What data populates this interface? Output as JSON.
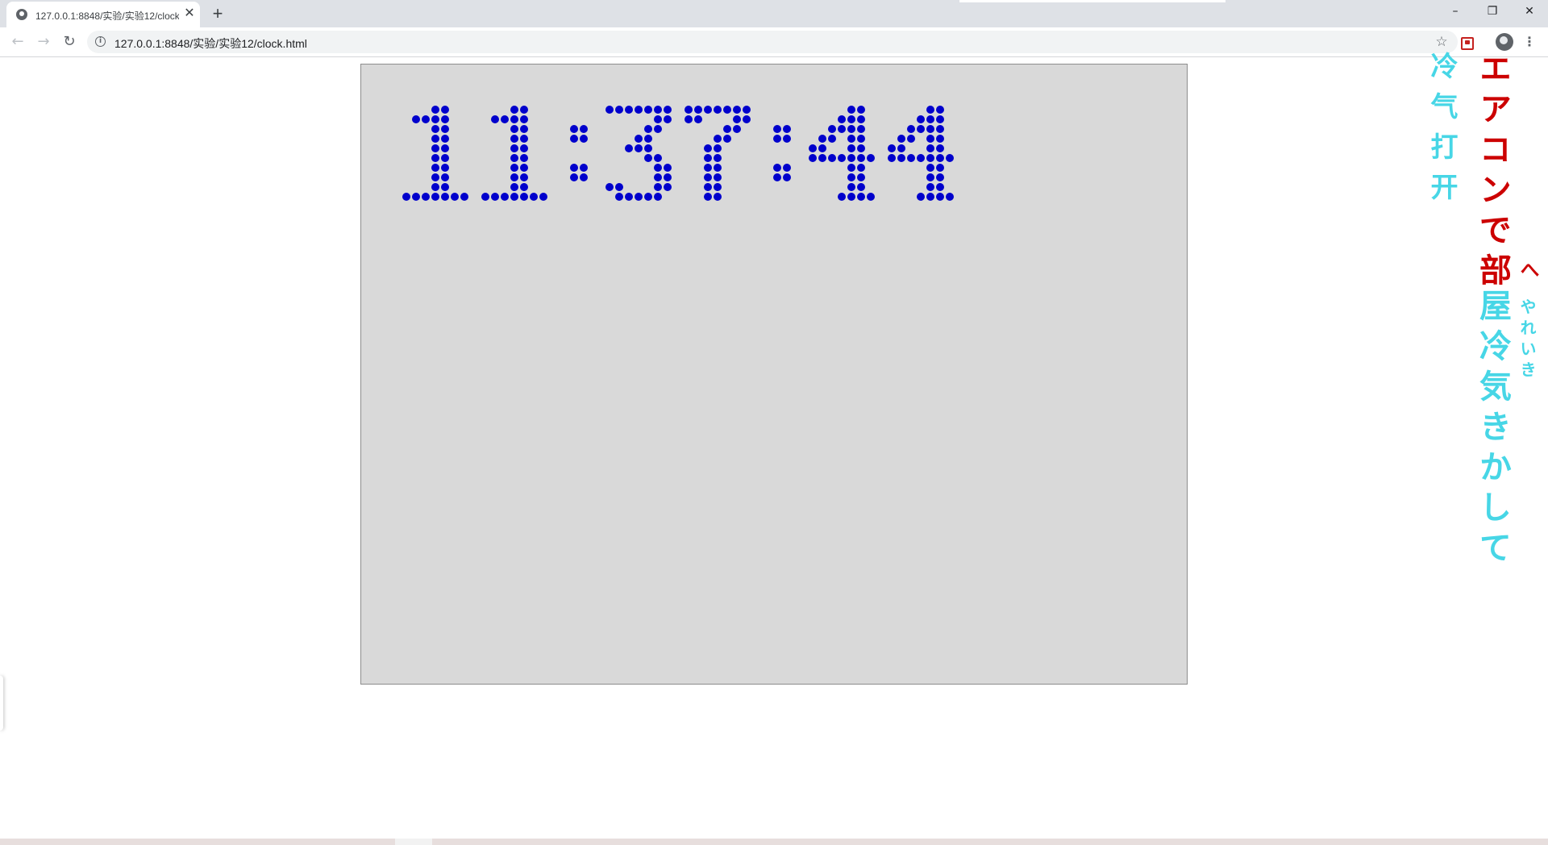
{
  "browser": {
    "tab": {
      "title": "127.0.0.1:8848/实验/实验12/clock.html",
      "favicon": "globe-icon"
    },
    "controls": {
      "new_tab": "+",
      "minimize": "–",
      "restore": "❐",
      "close": "✕",
      "back": "←",
      "forward": "→",
      "reload": "↻"
    },
    "omnibox": {
      "info": "i",
      "url": "127.0.0.1:8848/实验/实验12/clock.html",
      "star": "☆"
    },
    "extension_icon": "pocket-icon",
    "profile_icon": "avatar-icon",
    "menu": "⋮"
  },
  "clock": {
    "time": "11:37:44",
    "dot_color": "#0000cc",
    "background": "#d9d9d9"
  },
  "side_text": {
    "chinese_vertical": "冷气打开",
    "japanese_red": "エアコンで部",
    "japanese_cyan": "屋冷気きかして",
    "chevron": "へ",
    "furigana": "やれいき"
  },
  "colors": {
    "cyan": "#47d6e6",
    "red": "#cc0000"
  }
}
